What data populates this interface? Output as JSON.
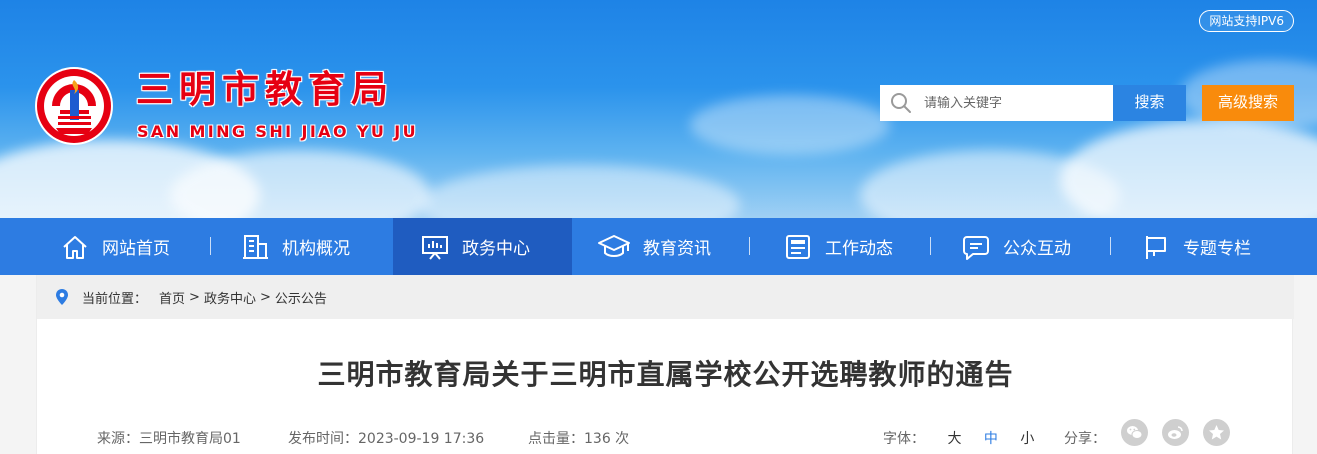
{
  "header": {
    "ipv6_badge": "网站支持IPV6",
    "title": "三明市教育局",
    "subtitle": "SAN MING SHI JIAO YU JU",
    "search_placeholder": "请输入关键字",
    "search_button": "搜索",
    "advanced_search_button": "高级搜索",
    "brand_color": "#e60012",
    "search_button_color": "#2b84e2",
    "advanced_search_color": "#f98b0c"
  },
  "nav": {
    "bar_color": "#2d7ce2",
    "active_color": "#1f5cc0",
    "items": [
      {
        "label": "网站首页",
        "icon": "home-icon"
      },
      {
        "label": "机构概况",
        "icon": "building-icon"
      },
      {
        "label": "政务中心",
        "icon": "presentation-board-icon",
        "active": true
      },
      {
        "label": "教育资讯",
        "icon": "graduation-cap-icon"
      },
      {
        "label": "工作动态",
        "icon": "news-document-icon"
      },
      {
        "label": "公众互动",
        "icon": "chat-bubble-icon"
      },
      {
        "label": "专题专栏",
        "icon": "flag-icon"
      }
    ]
  },
  "breadcrumb": {
    "label": "当前位置：",
    "items": [
      "首页",
      "政务中心",
      "公示公告"
    ],
    "separator": ">"
  },
  "article": {
    "title": "三明市教育局关于三明市直属学校公开选聘教师的通告",
    "source_label": "来源：",
    "source": "三明市教育局01",
    "publish_label": "发布时间：",
    "publish_time": "2023-09-19 17:36",
    "hits_label": "点击量：",
    "hits": "136 次",
    "font_label": "字体：",
    "font_sizes": [
      "大",
      "中",
      "小"
    ],
    "font_size_selected": "中",
    "share_label": "分享：",
    "share_icons": [
      "wechat-icon",
      "weibo-icon",
      "qzone-star-icon"
    ]
  }
}
